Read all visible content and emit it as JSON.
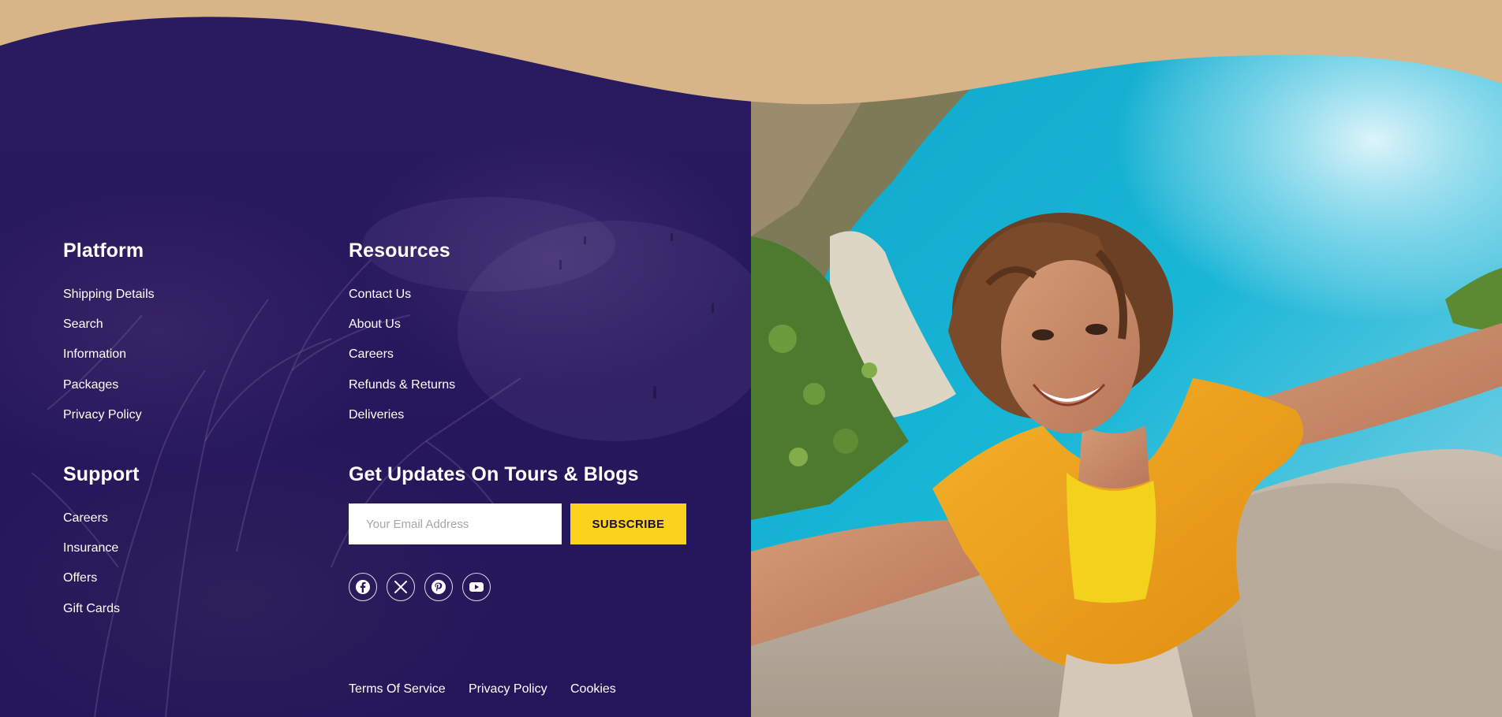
{
  "footer": {
    "platform": {
      "title": "Platform",
      "links": [
        "Shipping Details",
        "Search",
        "Information",
        "Packages",
        "Privacy Policy"
      ]
    },
    "resources": {
      "title": "Resources",
      "links": [
        "Contact Us",
        "About Us",
        "Careers",
        "Refunds & Returns",
        "Deliveries"
      ]
    },
    "support": {
      "title": "Support",
      "links": [
        "Careers",
        "Insurance",
        "Offers",
        "Gift Cards"
      ]
    },
    "newsletter": {
      "title": "Get Updates On Tours & Blogs",
      "email_placeholder": "Your Email Address",
      "email_value": "",
      "subscribe_label": "SUBSCRIBE"
    },
    "social": [
      "facebook-icon",
      "x-icon",
      "pinterest-icon",
      "youtube-icon"
    ],
    "legal": [
      "Terms Of Service",
      "Privacy Policy",
      "Cookies"
    ]
  },
  "colors": {
    "panel": "#27175c",
    "wave": "#d8b489",
    "accent": "#fbd31c",
    "text": "#ffffff"
  }
}
